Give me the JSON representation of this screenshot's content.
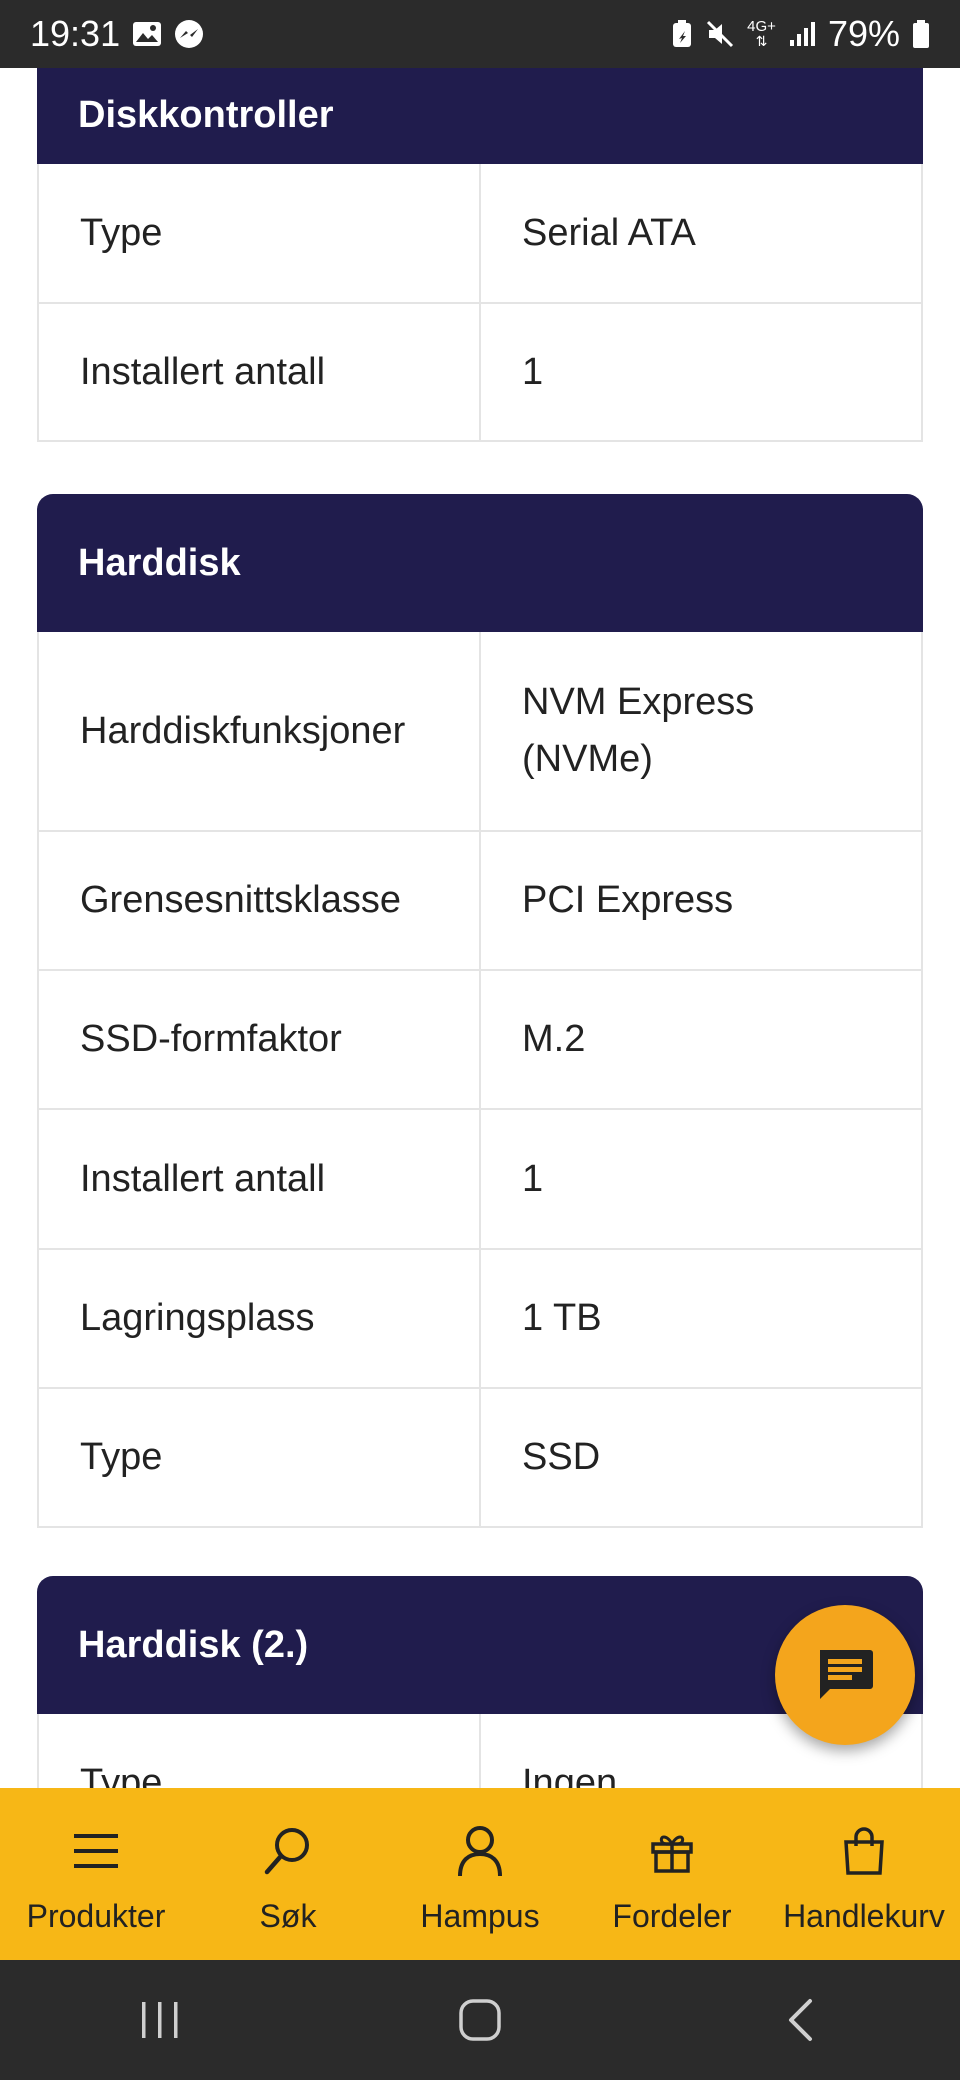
{
  "status_bar": {
    "time": "19:31",
    "battery": "79%",
    "network": "4G+",
    "icons_left": [
      "gallery-icon",
      "messenger-icon"
    ],
    "icons_right": [
      "battery-saver-icon",
      "mute-icon",
      "network-icon",
      "signal-icon",
      "battery-icon"
    ]
  },
  "sections": [
    {
      "title": "Diskkontroller",
      "rows": [
        {
          "label": "Type",
          "value": "Serial ATA"
        },
        {
          "label": "Installert antall",
          "value": "1"
        }
      ]
    },
    {
      "title": "Harddisk",
      "rows": [
        {
          "label": "Harddiskfunksjoner",
          "value": "NVM Express (NVMe)"
        },
        {
          "label": "Grensesnittsklasse",
          "value": "PCI Express"
        },
        {
          "label": "SSD-formfaktor",
          "value": "M.2"
        },
        {
          "label": "Installert antall",
          "value": "1"
        },
        {
          "label": "Lagringsplass",
          "value": "1 TB"
        },
        {
          "label": "Type",
          "value": "SSD"
        }
      ]
    },
    {
      "title": "Harddisk (2.)",
      "rows": [
        {
          "label": "Type",
          "value": "Ingen"
        }
      ]
    }
  ],
  "chat_button": {
    "icon": "chat-icon"
  },
  "bottom_nav": [
    {
      "label": "Produkter",
      "icon": "menu-icon"
    },
    {
      "label": "Søk",
      "icon": "search-icon"
    },
    {
      "label": "Hampus",
      "icon": "user-icon"
    },
    {
      "label": "Fordeler",
      "icon": "gift-icon"
    },
    {
      "label": "Handlekurv",
      "icon": "bag-icon"
    }
  ],
  "colors": {
    "header": "#201c4d",
    "nav": "#f7b716",
    "fab": "#f4a51c",
    "system": "#2b2b2b"
  }
}
